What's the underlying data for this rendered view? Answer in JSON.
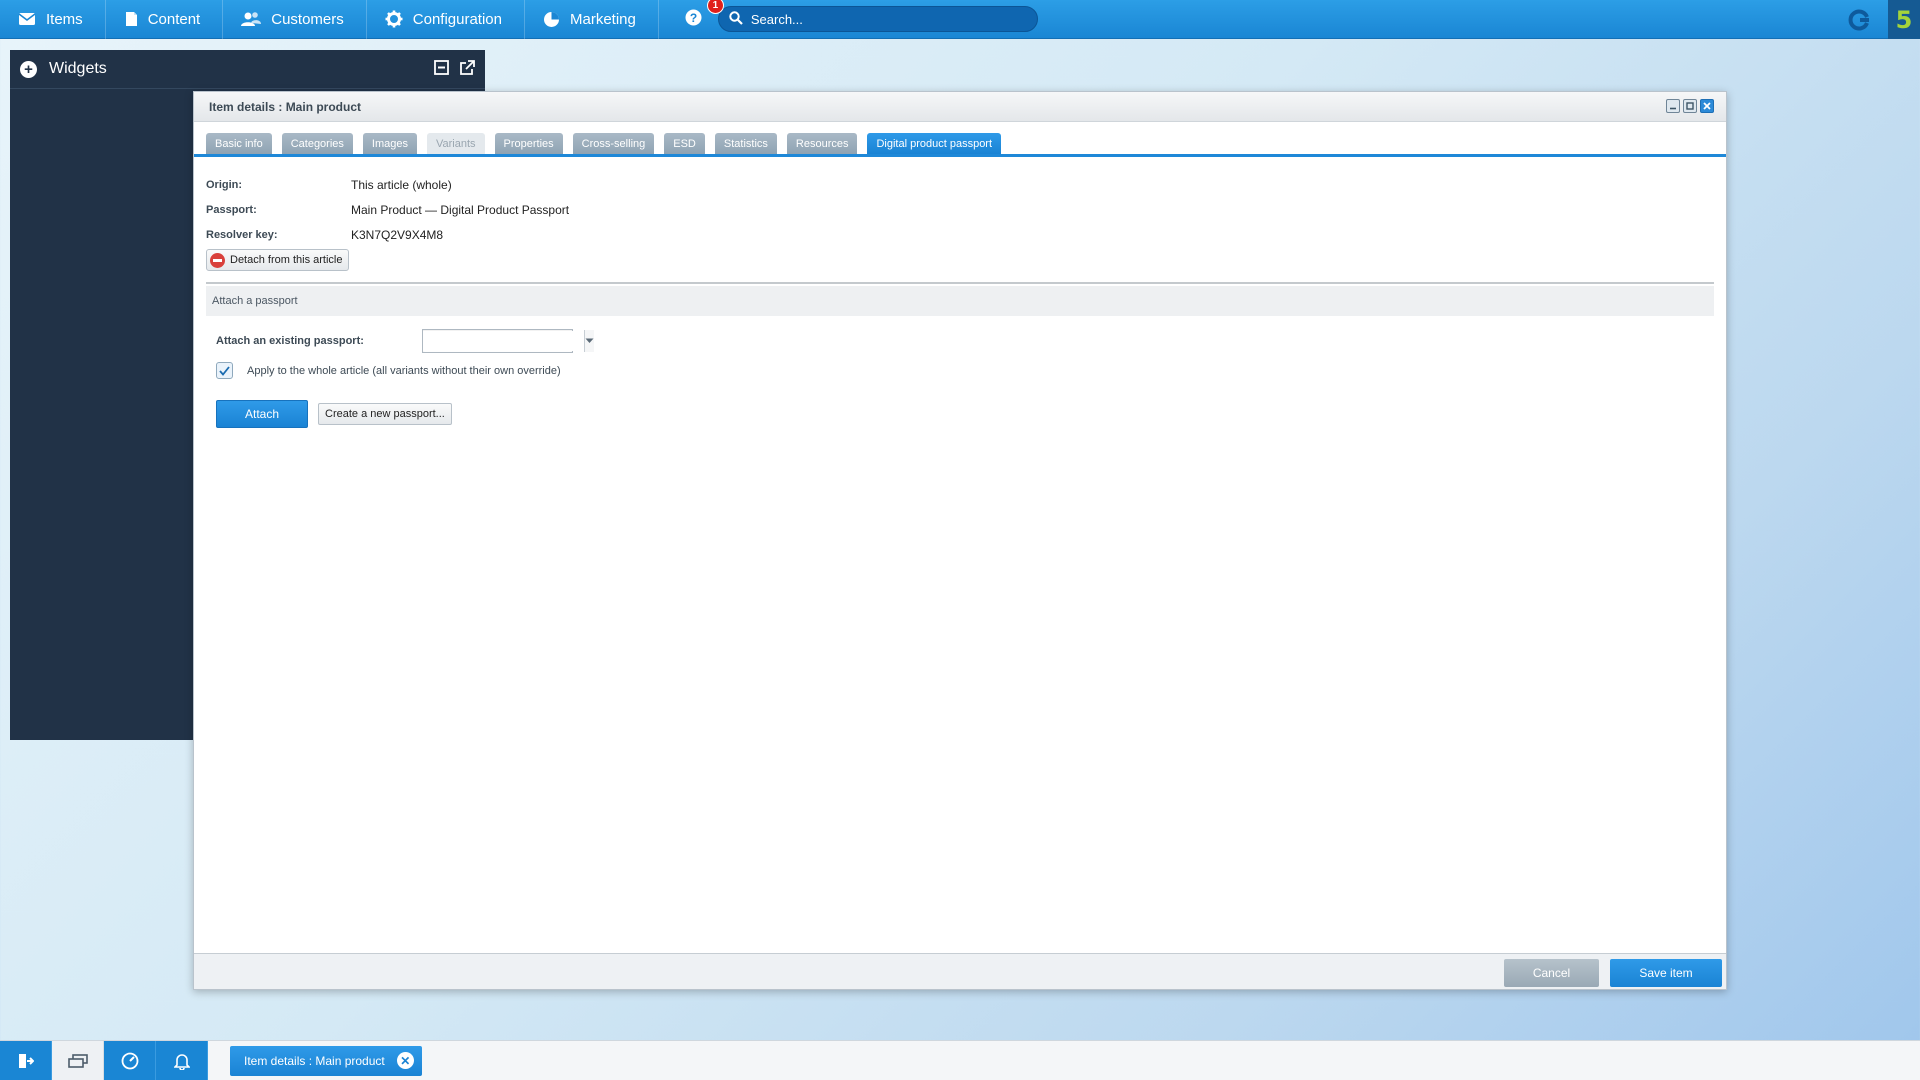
{
  "nav": {
    "items": [
      {
        "label": "Items",
        "icon": "inbox-icon"
      },
      {
        "label": "Content",
        "icon": "document-icon"
      },
      {
        "label": "Customers",
        "icon": "users-icon"
      },
      {
        "label": "Configuration",
        "icon": "gear-icon"
      },
      {
        "label": "Marketing",
        "icon": "pie-chart-icon"
      }
    ],
    "notification_count": "1",
    "search_placeholder": "Search...",
    "logo_text": "5"
  },
  "widgets": {
    "title": "Widgets"
  },
  "dialog": {
    "title": "Item details : Main product",
    "tabs": [
      {
        "label": "Basic info",
        "state": "normal"
      },
      {
        "label": "Categories",
        "state": "normal"
      },
      {
        "label": "Images",
        "state": "normal"
      },
      {
        "label": "Variants",
        "state": "disabled"
      },
      {
        "label": "Properties",
        "state": "normal"
      },
      {
        "label": "Cross-selling",
        "state": "normal"
      },
      {
        "label": "ESD",
        "state": "normal"
      },
      {
        "label": "Statistics",
        "state": "normal"
      },
      {
        "label": "Resources",
        "state": "normal"
      },
      {
        "label": "Digital product passport",
        "state": "active"
      }
    ],
    "info": {
      "origin_label": "Origin:",
      "origin_value": "This article (whole)",
      "passport_label": "Passport:",
      "passport_value": "Main Product — Digital Product Passport",
      "resolver_label": "Resolver key:",
      "resolver_value": "K3N7Q2V9X4M8",
      "detach_label": "Detach from this article"
    },
    "attach": {
      "section_title": "Attach a passport",
      "existing_label": "Attach an existing passport:",
      "existing_value": "",
      "apply_label": "Apply to the whole article (all variants without their own override)",
      "apply_checked": true,
      "attach_button": "Attach",
      "create_button": "Create a new passport..."
    },
    "footer": {
      "cancel": "Cancel",
      "save": "Save item"
    }
  },
  "taskbar": {
    "task_label": "Item details : Main product"
  },
  "colors": {
    "accent": "#1a86d4",
    "widgets_bg": "#213247",
    "danger": "#d9403b"
  }
}
